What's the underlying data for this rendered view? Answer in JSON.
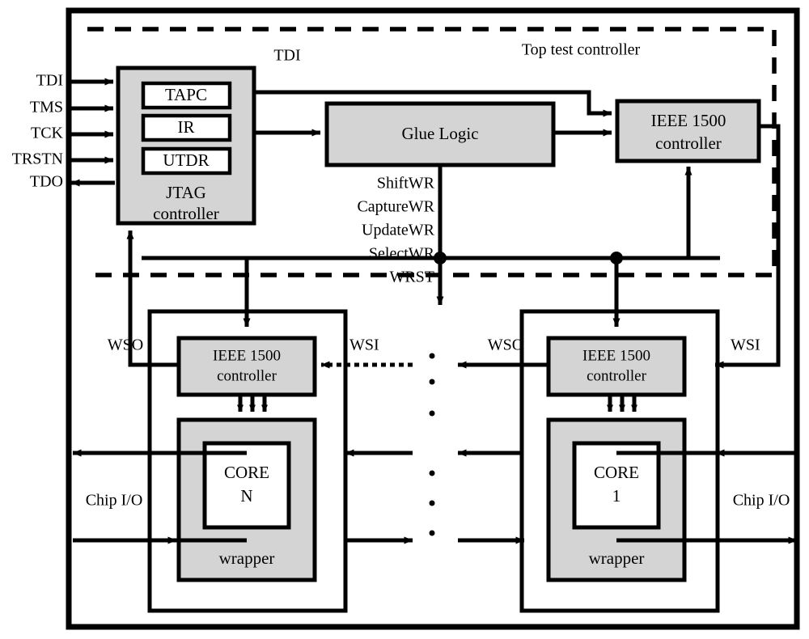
{
  "diagram": {
    "title": "Top test controller",
    "chip_boundary_name": "chip-outline",
    "colors": {
      "block_fill": "#d4d4d4",
      "stroke": "#000000",
      "background": "#ffffff"
    }
  },
  "top_region": {
    "label": "Top test controller",
    "jtag": {
      "name": "JTAG controller",
      "line1": "JTAG",
      "line2": "controller",
      "subblocks": [
        {
          "label": "TAPC"
        },
        {
          "label": "IR"
        },
        {
          "label": "UTDR"
        }
      ]
    },
    "glue_logic": {
      "label": "Glue Logic"
    },
    "ieee1500_top": {
      "line1": "IEEE 1500",
      "line2": "controller"
    },
    "tdi_label": "TDI"
  },
  "chip_pins": {
    "inputs": [
      {
        "label": "TDI"
      },
      {
        "label": "TMS"
      },
      {
        "label": "TCK"
      },
      {
        "label": "TRSTN"
      }
    ],
    "outputs": [
      {
        "label": "TDO"
      }
    ]
  },
  "wr_signals": [
    {
      "label": "ShiftWR"
    },
    {
      "label": "CaptureWR"
    },
    {
      "label": "UpdateWR"
    },
    {
      "label": "SelectWR"
    },
    {
      "label": "WRST"
    }
  ],
  "cores": [
    {
      "id": "core-n",
      "controller_line1": "IEEE 1500",
      "controller_line2": "controller",
      "core_line1": "CORE",
      "core_line2": "N",
      "wrapper_label": "wrapper",
      "wso_label": "WSO",
      "wsi_label": "WSI",
      "chip_io_label": "Chip I/O"
    },
    {
      "id": "core-1",
      "controller_line1": "IEEE 1500",
      "controller_line2": "controller",
      "core_line1": "CORE",
      "core_line2": "1",
      "wrapper_label": "wrapper",
      "wso_label": "WSO",
      "wsi_label": "WSI",
      "chip_io_label": "Chip I/O"
    }
  ],
  "ellipsis": {
    "label": "vertical-dots",
    "count": 6
  }
}
